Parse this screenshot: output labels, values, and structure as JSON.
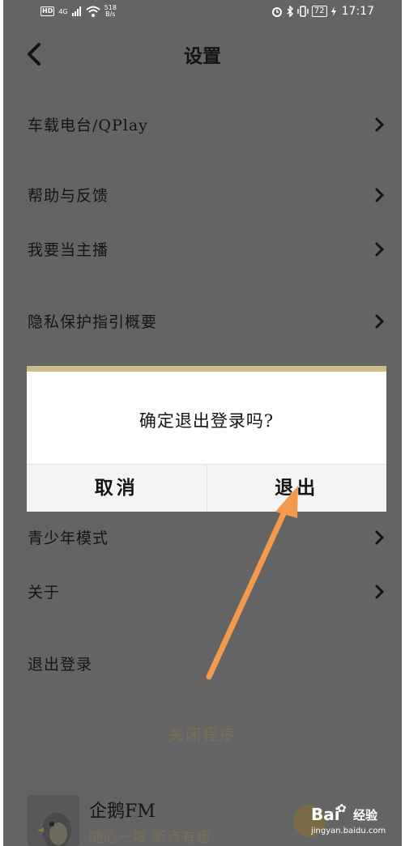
{
  "status_bar": {
    "hd": "HD",
    "network": "4G",
    "speed_value": "518",
    "speed_unit": "B/s",
    "battery": "72",
    "time": "17:17"
  },
  "header": {
    "title": "设置"
  },
  "settings": {
    "rows": [
      {
        "label": "车载电台/QPlay"
      },
      {
        "label": "帮助与反馈"
      },
      {
        "label": "我要当主播"
      },
      {
        "label": "隐私保护指引概要"
      },
      {
        "label": "青少年模式"
      },
      {
        "label": "关于"
      },
      {
        "label": "退出登录"
      }
    ],
    "close_program": "关闭程序"
  },
  "app": {
    "name": "企鹅FM",
    "slogan": "随心一按 听点有趣"
  },
  "dialog": {
    "message": "确定退出登录吗?",
    "cancel_label": "取消",
    "confirm_label": "退出"
  },
  "watermark": {
    "logo": "Bai",
    "brand": "经验",
    "url": "jingyan.baidu.com"
  },
  "colors": {
    "overlay": "#646464",
    "dialog_accent": "#cdbb8a",
    "arrow": "#f39a4e"
  }
}
